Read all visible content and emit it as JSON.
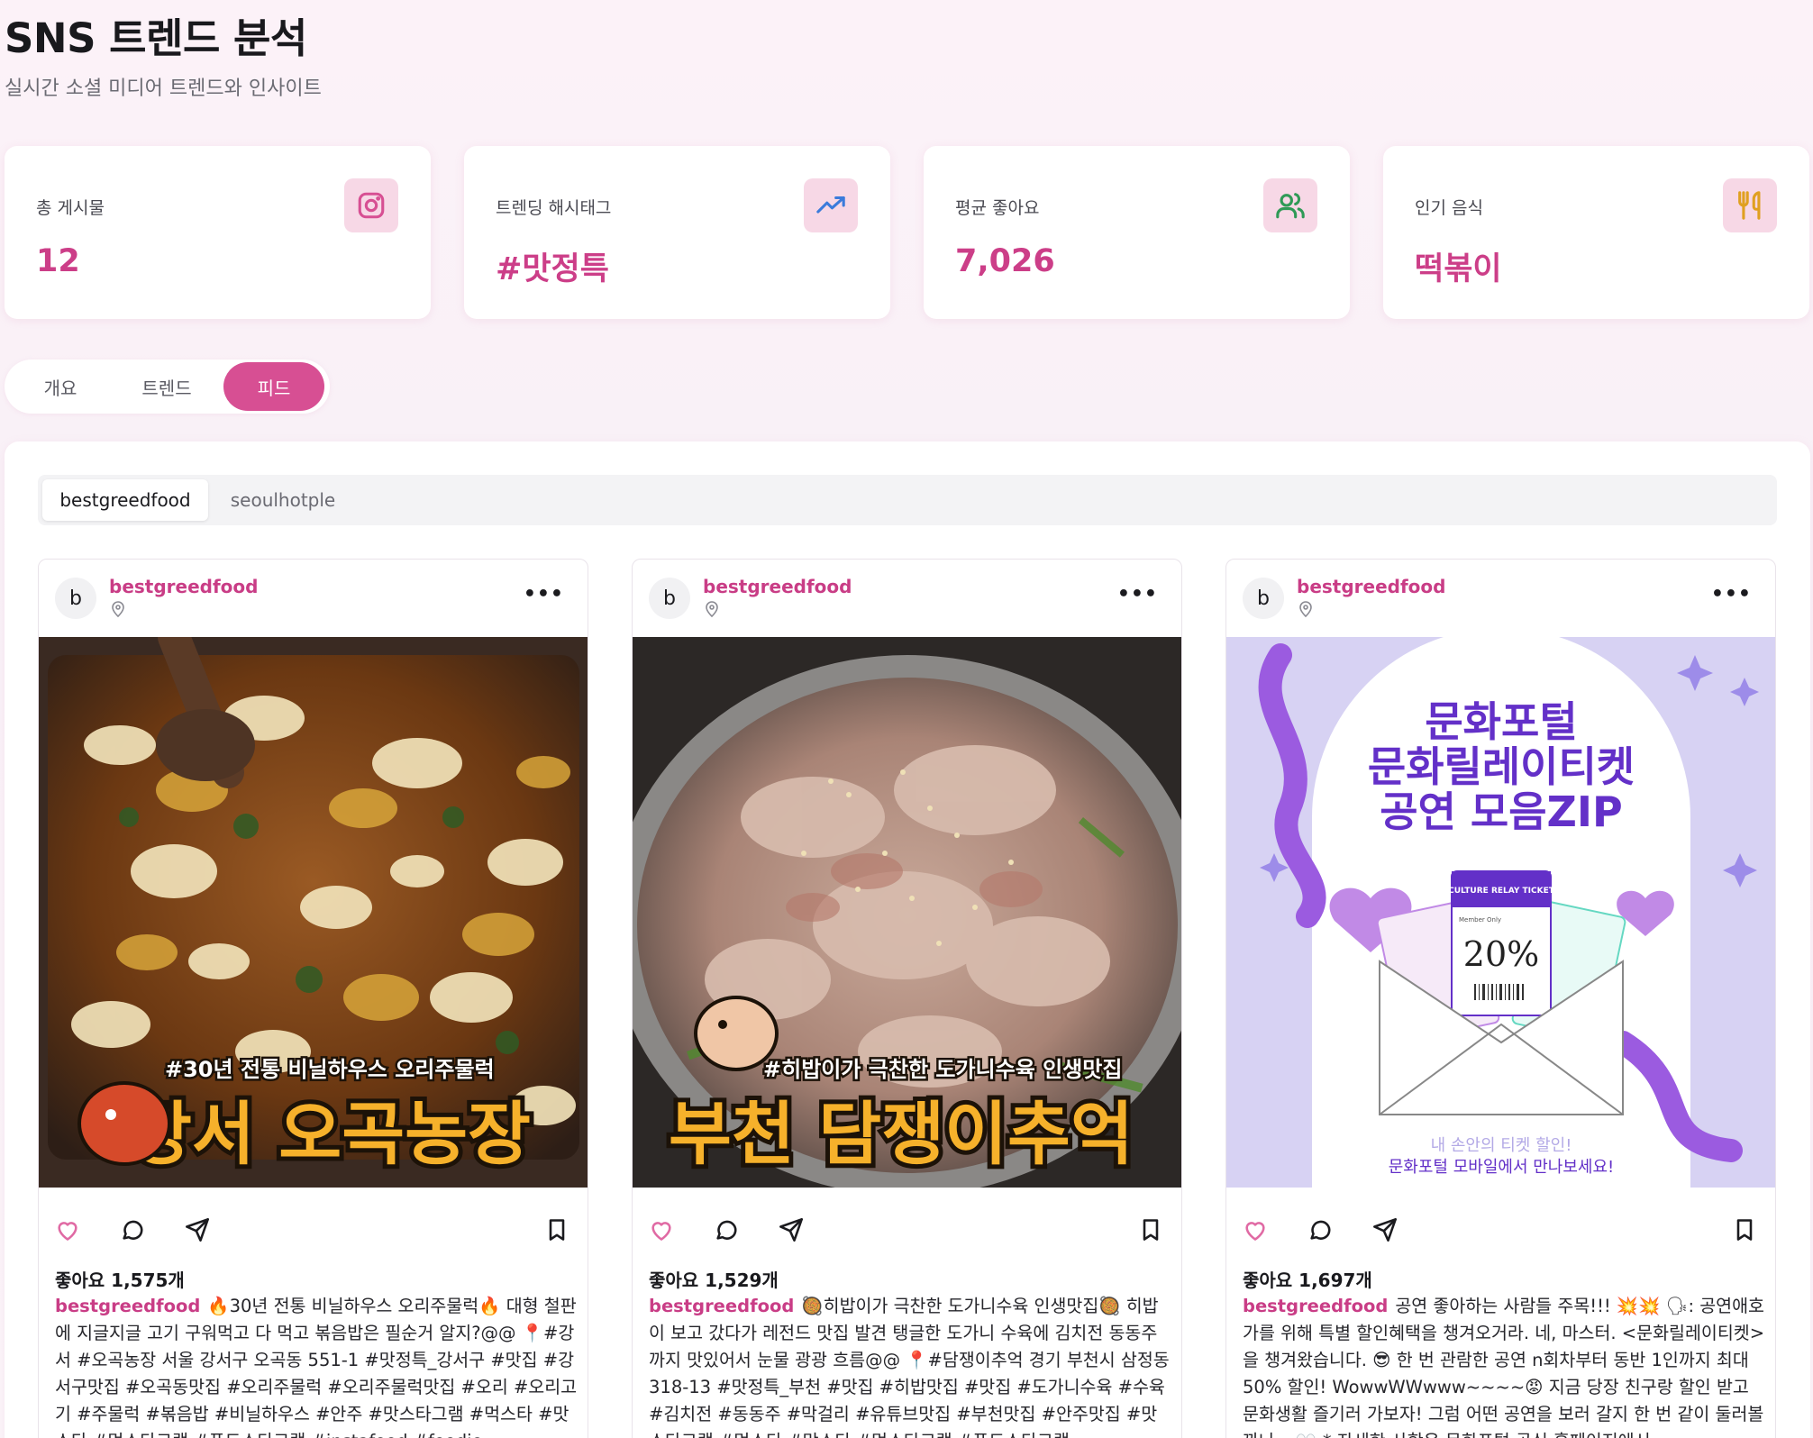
{
  "header": {
    "title": "SNS 트렌드 분석",
    "subtitle": "실시간 소셜 미디어 트렌드와 인사이트"
  },
  "stats": [
    {
      "label": "총 게시물",
      "value": "12",
      "icon": "instagram-icon"
    },
    {
      "label": "트렌딩 해시태그",
      "value": "#맛정특",
      "icon": "trending-up-icon"
    },
    {
      "label": "평균 좋아요",
      "value": "7,026",
      "icon": "users-icon"
    },
    {
      "label": "인기 음식",
      "value": "떡볶이",
      "icon": "utensils-icon"
    }
  ],
  "tabs": [
    "개요",
    "트렌드",
    "피드"
  ],
  "active_tab": "피드",
  "account_tabs": [
    "bestgreedfood",
    "seoulhotple"
  ],
  "active_account": "bestgreedfood",
  "posts": [
    {
      "avatar": "b",
      "username": "bestgreedfood",
      "image_text": {
        "small": "#30년 전통 비닐하우스 오리주물럭",
        "big": "강서 오곡농장"
      },
      "likes": "좋아요 1,575개",
      "caption_user": "bestgreedfood",
      "caption": "🔥30년 전통 비닐하우스 오리주물럭🔥 대형 철판에 지글지글 고기 구워먹고 다 먹고 볶음밥은 필순거 알지?@@ 📍#강서 #오곡농장 서울 강서구 오곡동 551-1 #맛정특_강서구 #맛집 #강서구맛집 #오곡동맛집 #오리주물럭 #오리주물럭맛집 #오리 #오리고기 #주물럭 #볶음밥 #비닐하우스 #안주 #맛스타그램 #먹스타 #맛스타 #먹스타그램 #푸드스타그램 #instafood #foodie #foodporn #야식 #좋"
    },
    {
      "avatar": "b",
      "username": "bestgreedfood",
      "image_text": {
        "small": "#히밥이가 극찬한 도가니수육 인생맛집",
        "big": "부천 담쟁이추억"
      },
      "likes": "좋아요 1,529개",
      "caption_user": "bestgreedfood",
      "caption": "🥘히밥이가 극찬한 도가니수육 인생맛집🥘 히밥이 보고 갔다가 레전드 맛집 발견 탱글한 도가니 수육에 김치전 동동주까지 맛있어서 눈물 광광 흐름@@ 📍#담쟁이추억 경기 부천시 삼정동 318-13 #맛정특_부천 #맛집 #히밥맛집 #맛집 #도가니수육 #수육 #김치전 #동동주 #막걸리 #유튜브맛집 #부천맛집 #안주맛집 #맛스타그램 #먹스타 #맛스타 #먹스타그램 #푸드스타그램 #instafood #foodie"
    },
    {
      "avatar": "b",
      "username": "bestgreedfood",
      "image_text": {
        "line1": "문화포털",
        "line2": "문화릴레이티켓",
        "line3": "공연 모음ZIP",
        "ticket_title": "CULTURE RELAY TICKET",
        "member": "Member Only",
        "discount": "20%",
        "bottom1": "내 손안의 티켓 할인!",
        "bottom2": "문화포털 모바일에서 만나보세요!"
      },
      "likes": "좋아요 1,697개",
      "caption_user": "bestgreedfood",
      "caption": "공연 좋아하는 사람들 주목!!! 💥💥 🗣: 공연애호가를 위해 특별 할인혜택을 챙겨오거라. 네, 마스터. <문화릴레이티켓>을 챙겨왔습니다. 😎 한 번 관람한 공연 n회차부터 동반 1인까지 최대 50% 할인! WowwWWwww~~~~😡 지금 당장 친구랑 할인 받고 문화생활 즐기러 가보자! 그럼 어떤 공연을 보러 갈지 한 번 같이 둘러볼까나~ 👀 * 자세한 사항은 문화포털 공식 홈페이지에서"
    }
  ],
  "colors": {
    "accent": "#d74f93",
    "stat_value": "#cc3e88",
    "icon_bg": "#f7d8e6",
    "username": "#c93d86"
  }
}
